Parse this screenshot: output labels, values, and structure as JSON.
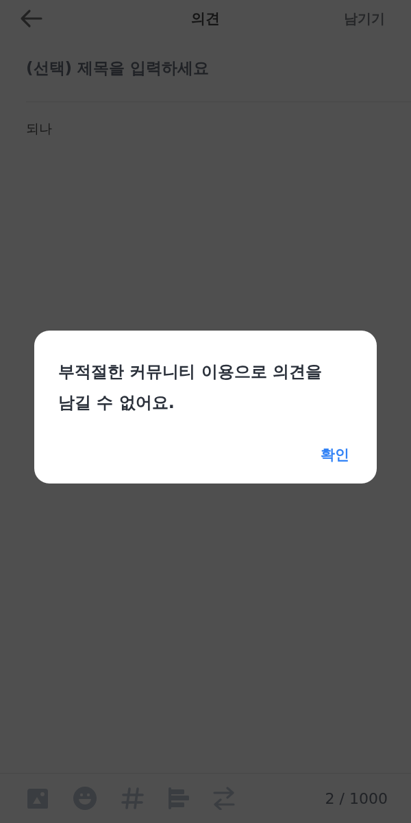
{
  "header": {
    "title": "의견",
    "submit": {
      "label": "남기기",
      "disabled": true
    }
  },
  "title_field": {
    "placeholder": "(선택) 제목을 입력하세요"
  },
  "body_field": {
    "value": "되나"
  },
  "toolbar": {
    "tools": [
      {
        "kind": "image"
      },
      {
        "kind": "emoji"
      },
      {
        "kind": "hashtag"
      },
      {
        "kind": "align"
      },
      {
        "kind": "swap"
      }
    ],
    "counter": "2 / 1000"
  },
  "dialog": {
    "message": "부적절한 커뮤니티 이용으로 의견을 남길 수 없어요.",
    "confirm": "확인"
  }
}
